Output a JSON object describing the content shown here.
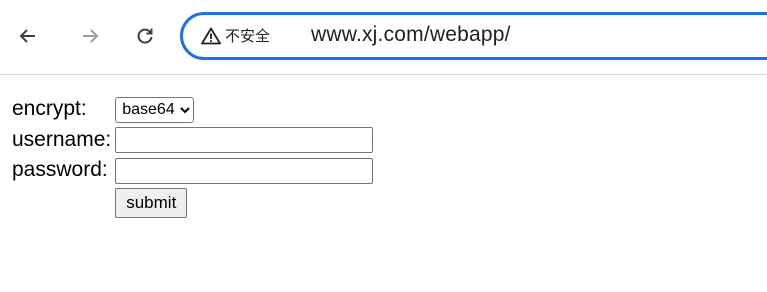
{
  "browser": {
    "security_label": "不安全",
    "url": "www.xj.com/webapp/",
    "accent_color": "#1a73e8"
  },
  "form": {
    "encrypt_label": "encrypt:",
    "encrypt_selected": "base64",
    "username_label": "username:",
    "username_value": "",
    "password_label": "password:",
    "password_value": "",
    "submit_label": "submit"
  },
  "icons": [
    "back-arrow-icon",
    "forward-arrow-icon",
    "reload-icon",
    "warning-icon",
    "chevron-down-icon"
  ]
}
